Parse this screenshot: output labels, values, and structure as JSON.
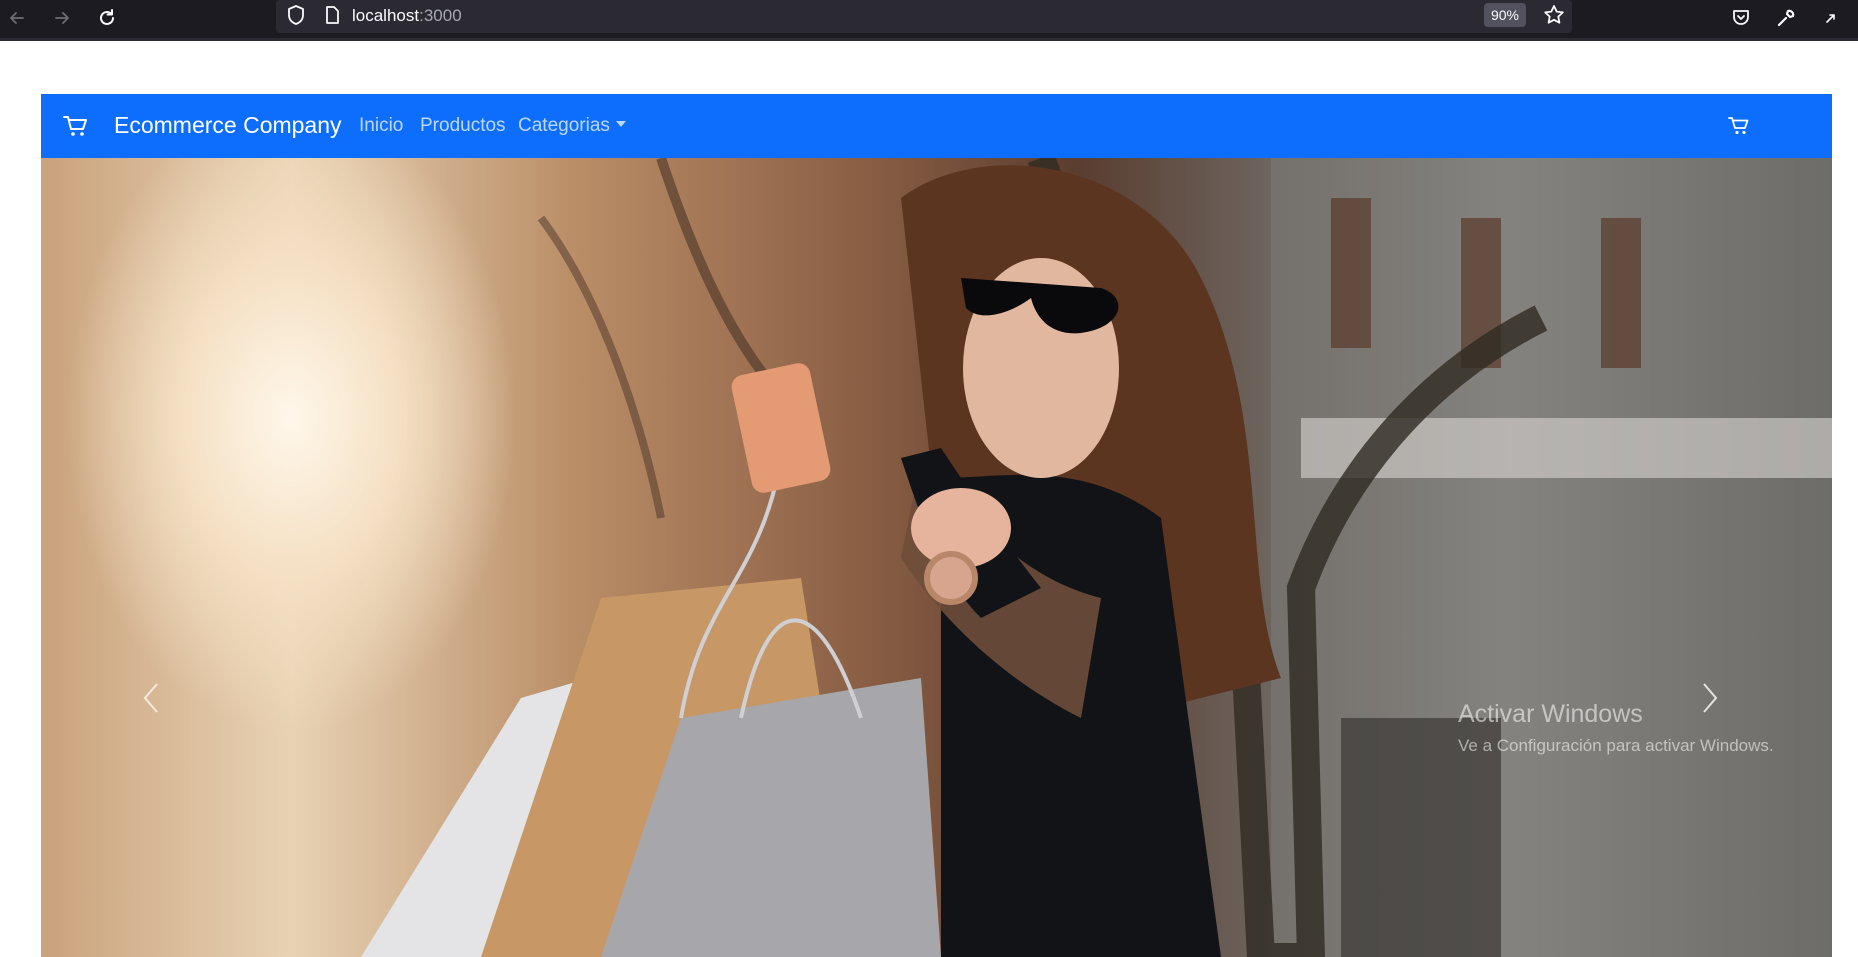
{
  "browser": {
    "url_host": "localhost",
    "url_port": ":3000",
    "zoom": "90%",
    "icons": [
      "back-arrow-icon",
      "forward-arrow-icon",
      "reload-icon",
      "shield-icon",
      "page-icon",
      "star-icon",
      "pocket-icon",
      "wrench-icon",
      "extension-icon"
    ]
  },
  "navbar": {
    "brand": "Ecommerce Company",
    "links": [
      "Inicio",
      "Productos",
      "Categorias"
    ],
    "accent_color": "#0d6efd"
  },
  "hero": {
    "image": "woman-with-shopping-bags-photo"
  },
  "watermark": {
    "title": "Activar Windows",
    "subtitle": "Ve a Configuración para activar Windows."
  }
}
